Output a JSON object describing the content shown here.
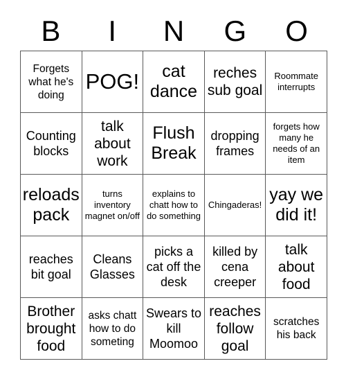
{
  "card": {
    "header_letters": [
      "B",
      "I",
      "N",
      "G",
      "O"
    ],
    "rows": [
      [
        {
          "text": "Forgets what he's doing",
          "size": "s"
        },
        {
          "text": "POG!",
          "size": "xxl"
        },
        {
          "text": "cat dance",
          "size": "xl"
        },
        {
          "text": "reches sub goal",
          "size": "l"
        },
        {
          "text": "Roommate interrupts",
          "size": "xs"
        }
      ],
      [
        {
          "text": "Counting blocks",
          "size": "m"
        },
        {
          "text": "talk about work",
          "size": "l"
        },
        {
          "text": "Flush Break",
          "size": "xl"
        },
        {
          "text": "dropping frames",
          "size": "m"
        },
        {
          "text": "forgets how many he needs of an item",
          "size": "xs"
        }
      ],
      [
        {
          "text": "reloads pack",
          "size": "xl"
        },
        {
          "text": "turns inventory magnet on/off",
          "size": "xs"
        },
        {
          "text": "explains to chatt how to do something",
          "size": "xs"
        },
        {
          "text": "Chingaderas!",
          "size": "xs"
        },
        {
          "text": "yay we did it!",
          "size": "xl"
        }
      ],
      [
        {
          "text": "reaches bit goal",
          "size": "m"
        },
        {
          "text": "Cleans Glasses",
          "size": "m"
        },
        {
          "text": "picks a cat off the desk",
          "size": "m"
        },
        {
          "text": "killed by cena creeper",
          "size": "m"
        },
        {
          "text": "talk about food",
          "size": "l"
        }
      ],
      [
        {
          "text": "Brother brought food",
          "size": "l"
        },
        {
          "text": "asks chatt how to do someting",
          "size": "s"
        },
        {
          "text": "Swears to kill Moomoo",
          "size": "m"
        },
        {
          "text": "reaches follow goal",
          "size": "l"
        },
        {
          "text": "scratches his back",
          "size": "s"
        }
      ]
    ]
  },
  "colors": {
    "background": "#ffffff",
    "text": "#000000",
    "grid_line": "#595959"
  }
}
